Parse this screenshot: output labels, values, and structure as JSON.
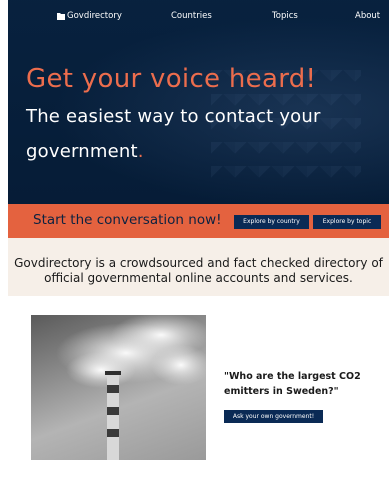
{
  "nav": {
    "brand": "Govdirectory",
    "items": [
      "Countries",
      "Topics",
      "About"
    ]
  },
  "hero": {
    "headline": "Get your voice heard!",
    "subtitle_line1": "The easiest way to contact your",
    "subtitle_line2": "government",
    "subtitle_dot": "."
  },
  "cta": {
    "text": "Start the conversation now!",
    "explore_country": "Explore by country",
    "explore_topic": "Explore by topic"
  },
  "description": "Govdirectory is a crowdsourced and fact checked directory of official governmental online accounts and services.",
  "feature": {
    "quote": "\"Who are the largest CO2 emitters in Sweden?\"",
    "button": "Ask your own government!"
  },
  "colors": {
    "hero_bg": "#07213e",
    "accent": "#ec6d4d",
    "cta_bar": "#e4623f",
    "button_bg": "#0a2a55",
    "description_bg": "#f6efe8"
  }
}
